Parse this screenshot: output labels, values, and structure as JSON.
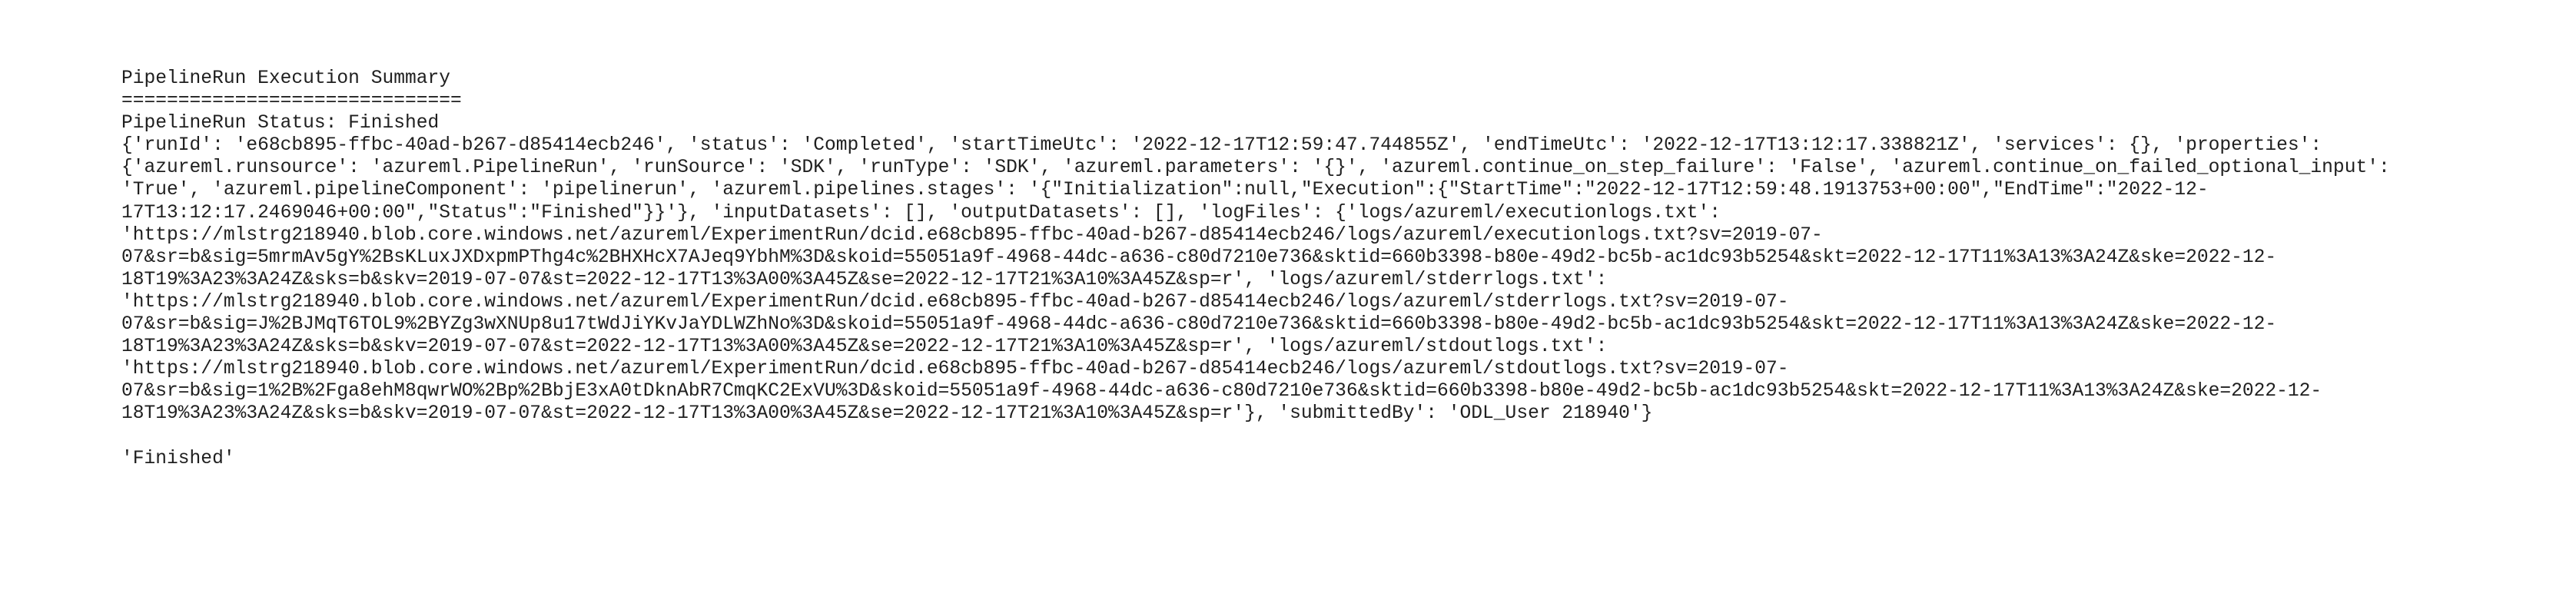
{
  "output": {
    "lines": [
      "PipelineRun Execution Summary",
      "==============================",
      "PipelineRun Status: Finished",
      "{'runId': 'e68cb895-ffbc-40ad-b267-d85414ecb246', 'status': 'Completed', 'startTimeUtc': '2022-12-17T12:59:47.744855Z', 'endTimeUtc': '2022-12-17T13:12:17.338821Z', 'services': {}, 'properties':",
      "{'azureml.runsource': 'azureml.PipelineRun', 'runSource': 'SDK', 'runType': 'SDK', 'azureml.parameters': '{}', 'azureml.continue_on_step_failure': 'False', 'azureml.continue_on_failed_optional_input':",
      "'True', 'azureml.pipelineComponent': 'pipelinerun', 'azureml.pipelines.stages': '{\"Initialization\":null,\"Execution\":{\"StartTime\":\"2022-12-17T12:59:48.1913753+00:00\",\"EndTime\":\"2022-12-",
      "17T13:12:17.2469046+00:00\",\"Status\":\"Finished\"}}'}, 'inputDatasets': [], 'outputDatasets': [], 'logFiles': {'logs/azureml/executionlogs.txt':",
      "'https://mlstrg218940.blob.core.windows.net/azureml/ExperimentRun/dcid.e68cb895-ffbc-40ad-b267-d85414ecb246/logs/azureml/executionlogs.txt?sv=2019-07-",
      "07&sr=b&sig=5mrmAv5gY%2BsKLuxJXDxpmPThg4c%2BHXHcX7AJeq9YbhM%3D&skoid=55051a9f-4968-44dc-a636-c80d7210e736&sktid=660b3398-b80e-49d2-bc5b-ac1dc93b5254&skt=2022-12-17T11%3A13%3A24Z&ske=2022-12-",
      "18T19%3A23%3A24Z&sks=b&skv=2019-07-07&st=2022-12-17T13%3A00%3A45Z&se=2022-12-17T21%3A10%3A45Z&sp=r', 'logs/azureml/stderrlogs.txt':",
      "'https://mlstrg218940.blob.core.windows.net/azureml/ExperimentRun/dcid.e68cb895-ffbc-40ad-b267-d85414ecb246/logs/azureml/stderrlogs.txt?sv=2019-07-",
      "07&sr=b&sig=J%2BJMqT6TOL9%2BYZg3wXNUp8u17tWdJiYKvJaYDLWZhNo%3D&skoid=55051a9f-4968-44dc-a636-c80d7210e736&sktid=660b3398-b80e-49d2-bc5b-ac1dc93b5254&skt=2022-12-17T11%3A13%3A24Z&ske=2022-12-",
      "18T19%3A23%3A24Z&sks=b&skv=2019-07-07&st=2022-12-17T13%3A00%3A45Z&se=2022-12-17T21%3A10%3A45Z&sp=r', 'logs/azureml/stdoutlogs.txt':",
      "'https://mlstrg218940.blob.core.windows.net/azureml/ExperimentRun/dcid.e68cb895-ffbc-40ad-b267-d85414ecb246/logs/azureml/stdoutlogs.txt?sv=2019-07-",
      "07&sr=b&sig=1%2B%2Fga8ehM8qwrWO%2Bp%2BbjE3xA0tDknAbR7CmqKC2ExVU%3D&skoid=55051a9f-4968-44dc-a636-c80d7210e736&sktid=660b3398-b80e-49d2-bc5b-ac1dc93b5254&skt=2022-12-17T11%3A13%3A24Z&ske=2022-12-",
      "18T19%3A23%3A24Z&sks=b&skv=2019-07-07&st=2022-12-17T13%3A00%3A45Z&se=2022-12-17T21%3A10%3A45Z&sp=r'}, 'submittedBy': 'ODL_User 218940'}"
    ],
    "result": "'Finished'"
  }
}
